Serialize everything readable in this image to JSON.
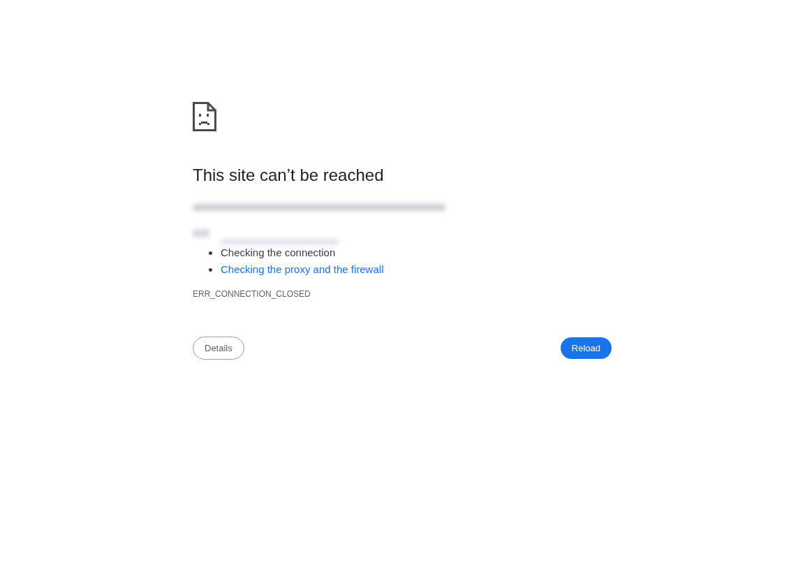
{
  "heading": "This site can’t be reached",
  "suggestions": [
    {
      "text": "Checking the connection",
      "kind": "plain"
    },
    {
      "text": "Checking the proxy and the firewall",
      "kind": "link"
    }
  ],
  "error_code": "ERR_CONNECTION_CLOSED",
  "buttons": [
    {
      "label": "Details",
      "kind": "secondary"
    },
    {
      "label": "Reload",
      "kind": "primary"
    }
  ]
}
